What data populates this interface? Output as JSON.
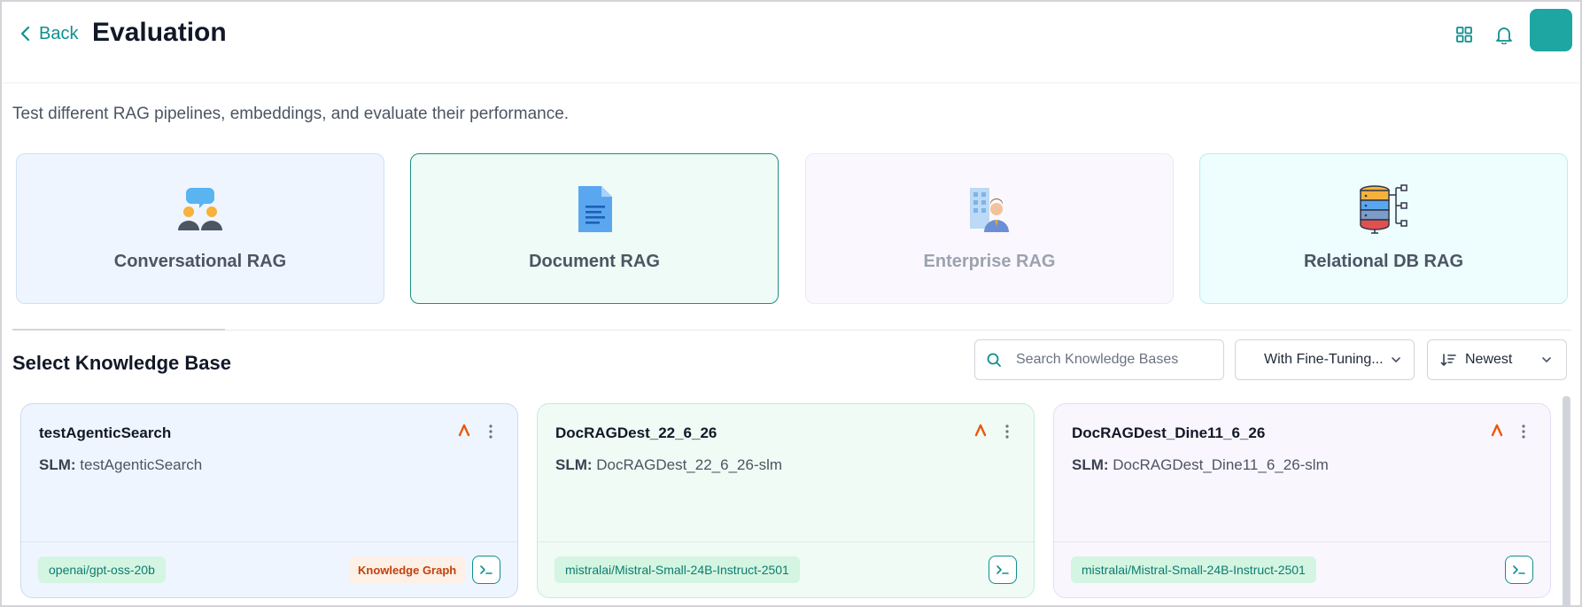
{
  "header": {
    "back_label": "Back",
    "title": "Evaluation",
    "icons": [
      "grid-icon",
      "bell-icon"
    ]
  },
  "subtitle": "Test different RAG pipelines, embeddings, and evaluate their performance.",
  "rag_types": [
    {
      "label": "Conversational RAG",
      "icon": "conversation-icon",
      "selected": false
    },
    {
      "label": "Document RAG",
      "icon": "document-icon",
      "selected": true
    },
    {
      "label": "Enterprise RAG",
      "icon": "enterprise-icon",
      "selected": false,
      "disabled": true
    },
    {
      "label": "Relational DB RAG",
      "icon": "database-icon",
      "selected": false
    }
  ],
  "knowledge_base": {
    "title": "Select Knowledge Base",
    "search_placeholder": "Search Knowledge Bases",
    "filter_label": "With Fine-Tuning...",
    "sort_label": "Newest",
    "cards": [
      {
        "name": "testAgenticSearch",
        "slm_label": "SLM:",
        "slm": "testAgenticSearch",
        "model": "openai/gpt-oss-20b",
        "badge": "Knowledge Graph"
      },
      {
        "name": "DocRAGDest_22_6_26",
        "slm_label": "SLM:",
        "slm": "DocRAGDest_22_6_26-slm",
        "model": "mistralai/Mistral-Small-24B-Instruct-2501"
      },
      {
        "name": "DocRAGDest_Dine11_6_26",
        "slm_label": "SLM:",
        "slm": "DocRAGDest_Dine11_6_26-slm",
        "model": "mistralai/Mistral-Small-24B-Instruct-2501"
      }
    ]
  },
  "colors": {
    "accent": "#0f8f8f",
    "caret": "#ea580c",
    "chip_bg": "#d3f5e2"
  }
}
